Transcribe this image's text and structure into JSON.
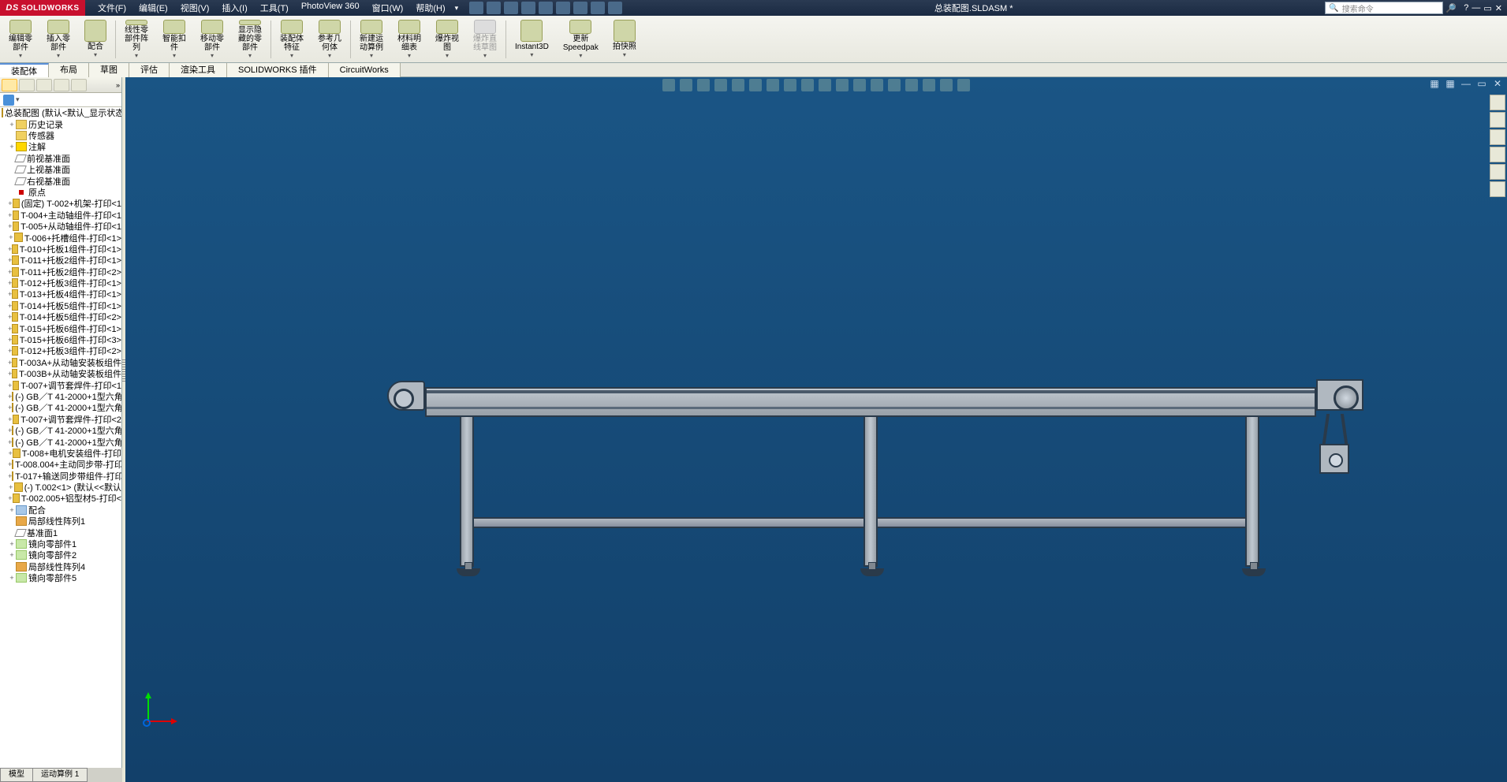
{
  "app": {
    "brand": "SOLIDWORKS",
    "doc_title": "总装配图.SLDASM *",
    "search_placeholder": "搜索命令"
  },
  "menus": [
    "文件(F)",
    "编辑(E)",
    "视图(V)",
    "插入(I)",
    "工具(T)",
    "PhotoView 360",
    "窗口(W)",
    "帮助(H)"
  ],
  "ribbon": [
    {
      "label": "编辑零\n部件",
      "gray": false
    },
    {
      "label": "插入零\n部件",
      "gray": false
    },
    {
      "label": "配合",
      "gray": false
    },
    {
      "label": "线性零\n部件阵\n列",
      "gray": false
    },
    {
      "label": "智能扣\n件",
      "gray": false
    },
    {
      "label": "移动零\n部件",
      "gray": false
    },
    {
      "label": "显示隐\n藏的零\n部件",
      "gray": false
    },
    {
      "label": "装配体\n特征",
      "gray": false
    },
    {
      "label": "参考几\n何体",
      "gray": false
    },
    {
      "label": "新建运\n动算例",
      "gray": false
    },
    {
      "label": "材料明\n细表",
      "gray": false
    },
    {
      "label": "爆炸视\n图",
      "gray": false
    },
    {
      "label": "爆炸直\n线草图",
      "gray": true
    },
    {
      "label": "Instant3D",
      "gray": false
    },
    {
      "label": "更新\nSpeedpak",
      "gray": false
    },
    {
      "label": "拍快照",
      "gray": false
    }
  ],
  "cmd_tabs": [
    "装配体",
    "布局",
    "草图",
    "评估",
    "渲染工具",
    "SOLIDWORKS 插件",
    "CircuitWorks"
  ],
  "tree_root": "总装配图  (默认<默认_显示状态",
  "tree": [
    {
      "icon": "fold",
      "label": "历史记录",
      "exp": "+",
      "lvl": 2
    },
    {
      "icon": "fold",
      "label": "传感器",
      "exp": "",
      "lvl": 2
    },
    {
      "icon": "note",
      "label": "注解",
      "exp": "+",
      "lvl": 2
    },
    {
      "icon": "plane",
      "label": "前视基准面",
      "exp": "",
      "lvl": 2
    },
    {
      "icon": "plane",
      "label": "上视基准面",
      "exp": "",
      "lvl": 2
    },
    {
      "icon": "plane",
      "label": "右视基准面",
      "exp": "",
      "lvl": 2
    },
    {
      "icon": "orig",
      "label": "原点",
      "exp": "",
      "lvl": 2
    },
    {
      "icon": "part",
      "label": "(固定) T-002+机架-打印<1",
      "exp": "+",
      "lvl": 2
    },
    {
      "icon": "part",
      "label": "T-004+主动轴组件-打印<1",
      "exp": "+",
      "lvl": 2
    },
    {
      "icon": "part",
      "label": "T-005+从动轴组件-打印<1",
      "exp": "+",
      "lvl": 2
    },
    {
      "icon": "part",
      "label": "T-006+托槽组件-打印<1>",
      "exp": "+",
      "lvl": 2
    },
    {
      "icon": "part",
      "label": "T-010+托板1组件-打印<1>",
      "exp": "+",
      "lvl": 2
    },
    {
      "icon": "part",
      "label": "T-011+托板2组件-打印<1>",
      "exp": "+",
      "lvl": 2
    },
    {
      "icon": "part",
      "label": "T-011+托板2组件-打印<2>",
      "exp": "+",
      "lvl": 2
    },
    {
      "icon": "part",
      "label": "T-012+托板3组件-打印<1>",
      "exp": "+",
      "lvl": 2
    },
    {
      "icon": "part",
      "label": "T-013+托板4组件-打印<1>",
      "exp": "+",
      "lvl": 2
    },
    {
      "icon": "part",
      "label": "T-014+托板5组件-打印<1>",
      "exp": "+",
      "lvl": 2
    },
    {
      "icon": "part",
      "label": "T-014+托板5组件-打印<2>",
      "exp": "+",
      "lvl": 2
    },
    {
      "icon": "part",
      "label": "T-015+托板6组件-打印<1>",
      "exp": "+",
      "lvl": 2
    },
    {
      "icon": "part",
      "label": "T-015+托板6组件-打印<3>",
      "exp": "+",
      "lvl": 2
    },
    {
      "icon": "part",
      "label": "T-012+托板3组件-打印<2>",
      "exp": "+",
      "lvl": 2
    },
    {
      "icon": "part",
      "label": "T-003A+从动轴安装板组件",
      "exp": "+",
      "lvl": 2
    },
    {
      "icon": "part",
      "label": "T-003B+从动轴安装板组件",
      "exp": "+",
      "lvl": 2
    },
    {
      "icon": "part",
      "label": "T-007+调节套焊件-打印<1",
      "exp": "+",
      "lvl": 2
    },
    {
      "icon": "part",
      "label": "(-) GB／T 41-2000+1型六角",
      "exp": "+",
      "lvl": 2
    },
    {
      "icon": "part",
      "label": "(-) GB／T 41-2000+1型六角",
      "exp": "+",
      "lvl": 2
    },
    {
      "icon": "part",
      "label": "T-007+调节套焊件-打印<2",
      "exp": "+",
      "lvl": 2
    },
    {
      "icon": "part",
      "label": "(-) GB／T 41-2000+1型六角",
      "exp": "+",
      "lvl": 2
    },
    {
      "icon": "part",
      "label": "(-) GB／T 41-2000+1型六角",
      "exp": "+",
      "lvl": 2
    },
    {
      "icon": "part",
      "label": "T-008+电机安装组件-打印",
      "exp": "+",
      "lvl": 2
    },
    {
      "icon": "part",
      "label": "T-008.004+主动同步带-打印",
      "exp": "+",
      "lvl": 2
    },
    {
      "icon": "part",
      "label": "T-017+输送同步带组件-打印",
      "exp": "+",
      "lvl": 2
    },
    {
      "icon": "part",
      "label": "(-) T.002<1> (默认<<默认",
      "exp": "+",
      "lvl": 2
    },
    {
      "icon": "part",
      "label": "T-002.005+铝型材5-打印<",
      "exp": "+",
      "lvl": 2
    },
    {
      "icon": "mate",
      "label": "配合",
      "exp": "+",
      "lvl": 2
    },
    {
      "icon": "patt",
      "label": "局部线性阵列1",
      "exp": "",
      "lvl": 2
    },
    {
      "icon": "plane",
      "label": "基准面1",
      "exp": "",
      "lvl": 2
    },
    {
      "icon": "mirr",
      "label": "镜向零部件1",
      "exp": "+",
      "lvl": 2
    },
    {
      "icon": "mirr",
      "label": "镜向零部件2",
      "exp": "+",
      "lvl": 2
    },
    {
      "icon": "patt",
      "label": "局部线性阵列4",
      "exp": "",
      "lvl": 2
    },
    {
      "icon": "mirr",
      "label": "镜向零部件5",
      "exp": "+",
      "lvl": 2
    }
  ],
  "bottom_tabs": [
    "模型",
    "运动算例 1"
  ]
}
